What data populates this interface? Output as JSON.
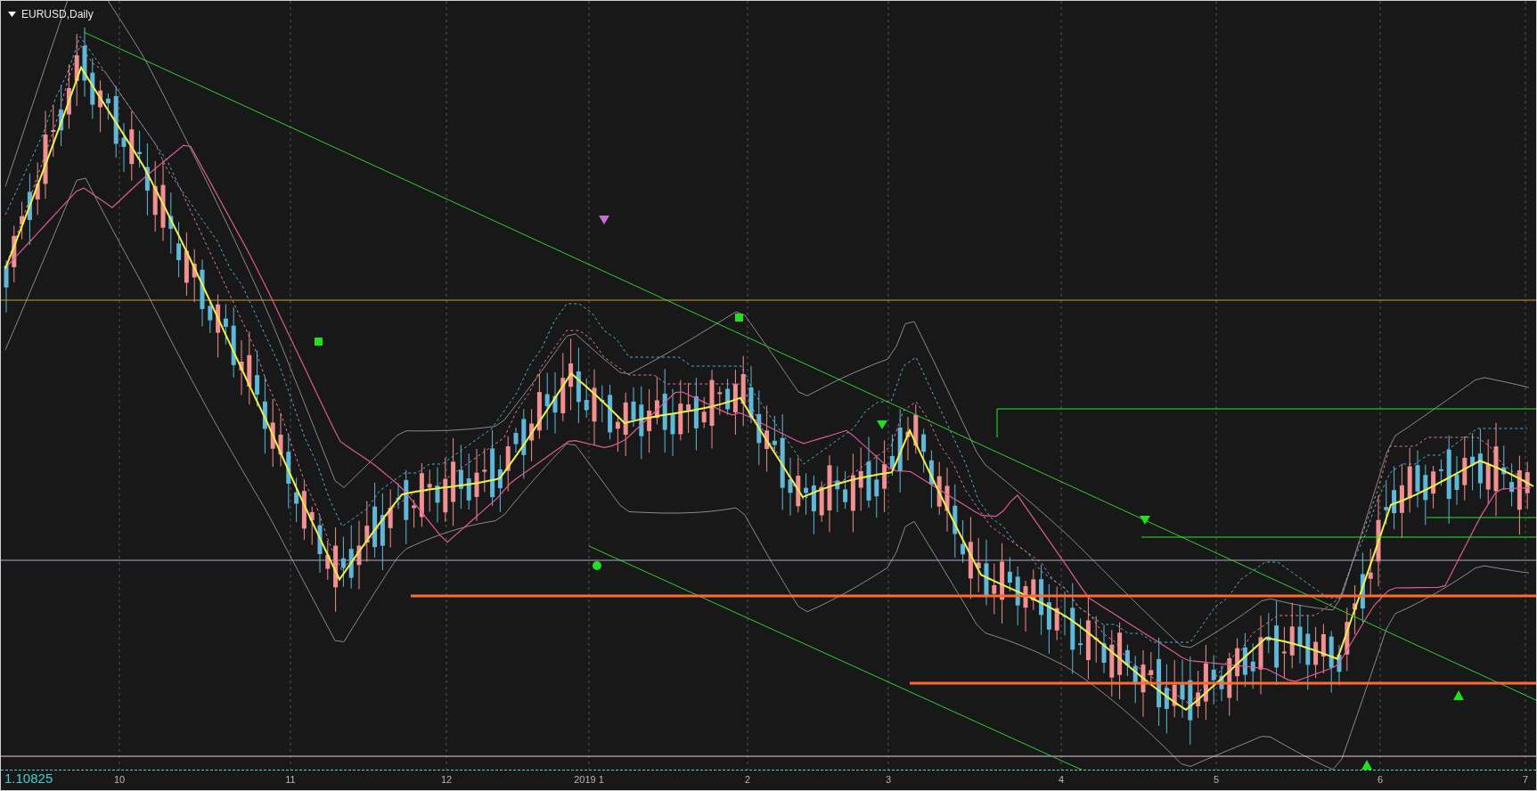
{
  "chart": {
    "title": "EURUSD,Daily",
    "price_label": "1.10825",
    "x_labels": [
      "10",
      "11",
      "12",
      "2019 1",
      "2",
      "3",
      "4",
      "5",
      "6",
      "7"
    ]
  }
}
